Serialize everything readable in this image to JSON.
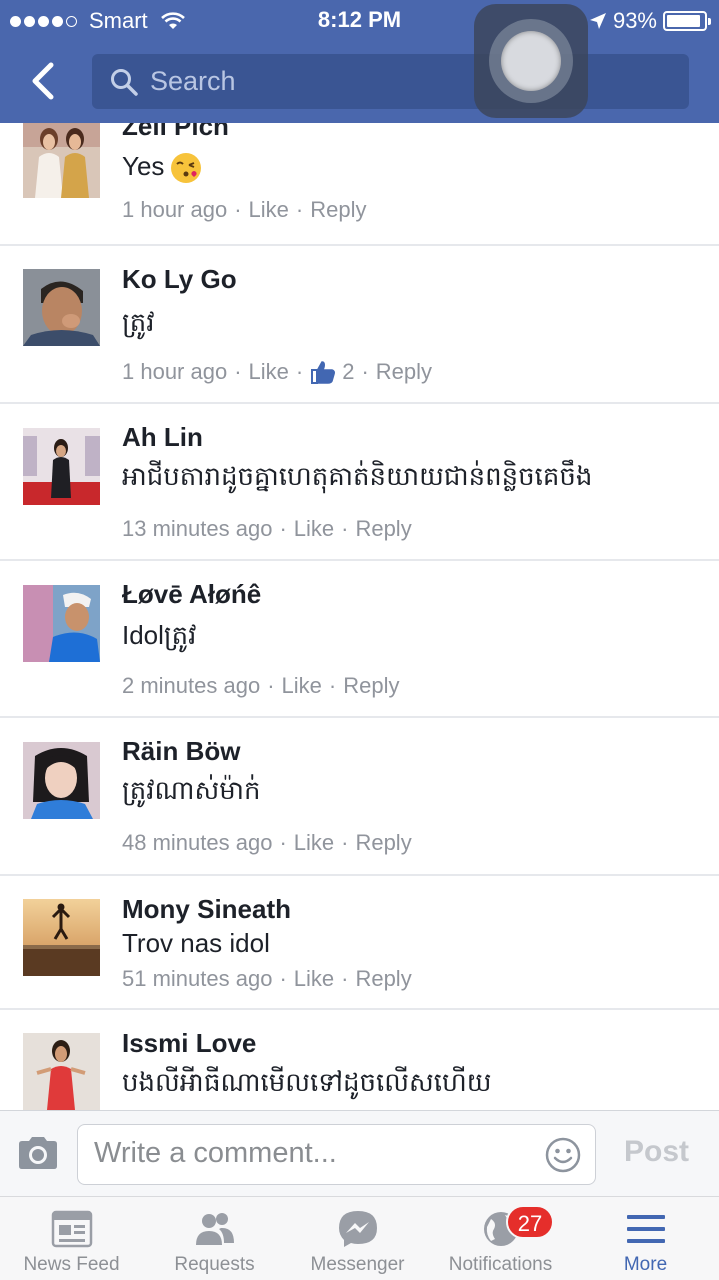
{
  "status_bar": {
    "carrier": "Smart",
    "time": "8:12 PM",
    "battery": "93%",
    "battery_level": 0.93
  },
  "header": {
    "search_placeholder": "Search"
  },
  "comments": [
    {
      "name": "Zeïi Pich",
      "text": "Yes",
      "emoji": "kissing-face-emoji",
      "time": "1 hour ago",
      "like": "Like",
      "reply": "Reply"
    },
    {
      "name": "Ko Ly Go",
      "text": "ត្រូវ",
      "time": "1 hour ago",
      "like": "Like",
      "likes_count": "2",
      "reply": "Reply"
    },
    {
      "name": "Ah Lin",
      "text": "អាជីបតារាដូចគ្នាហេតុគាត់និយាយជាន់ពន្លិចគេចឹង",
      "time": "13 minutes ago",
      "like": "Like",
      "reply": "Reply"
    },
    {
      "name": "Łøvē Ałøńê",
      "text": "Idolត្រូវ",
      "time": "2 minutes ago",
      "like": "Like",
      "reply": "Reply"
    },
    {
      "name": "Räin Böw",
      "text": "ត្រូវណាស់ម៉ាក់",
      "time": "48 minutes ago",
      "like": "Like",
      "reply": "Reply"
    },
    {
      "name": "Mony Sineath",
      "text": "Trov nas idol",
      "time": "51 minutes ago",
      "like": "Like",
      "reply": "Reply"
    },
    {
      "name": "Issmi Love",
      "text": "បងលីអីាធីណាមើលទៅដូចលើសហើយ"
    }
  ],
  "composer": {
    "placeholder": "Write a comment...",
    "post_label": "Post"
  },
  "tabs": [
    {
      "label": "News Feed",
      "icon": "news-feed-icon"
    },
    {
      "label": "Requests",
      "icon": "friend-requests-icon"
    },
    {
      "label": "Messenger",
      "icon": "messenger-icon"
    },
    {
      "label": "Notifications",
      "icon": "globe-icon",
      "badge": "27"
    },
    {
      "label": "More",
      "icon": "hamburger-menu-icon",
      "active": true
    }
  ],
  "colors": {
    "header_bg": "#4a67ad",
    "search_bg": "#3a5593",
    "link_gray": "#90949c",
    "active_tab": "#4267b2",
    "badge_red": "#e52e2b"
  }
}
